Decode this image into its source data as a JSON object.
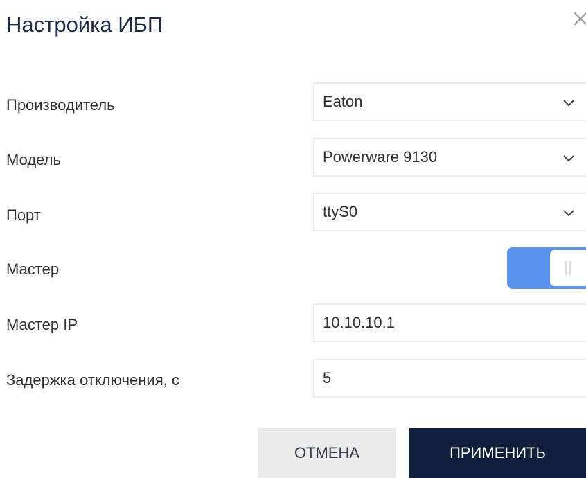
{
  "dialog": {
    "title": "Настройка ИБП",
    "close_icon": "close-icon"
  },
  "form": {
    "manufacturer": {
      "label": "Производитель",
      "value": "Eaton",
      "icon": "chevron-down-icon"
    },
    "model": {
      "label": "Модель",
      "value": "Powerware 9130",
      "icon": "chevron-down-icon"
    },
    "port": {
      "label": "Порт",
      "value": "ttyS0",
      "icon": "chevron-down-icon"
    },
    "master": {
      "label": "Мастер",
      "enabled": true
    },
    "master_ip": {
      "label": "Мастер IP",
      "value": "10.10.10.1"
    },
    "shutdown_delay": {
      "label": "Задержка отключения, с",
      "value": "5"
    }
  },
  "actions": {
    "cancel_label": "ОТМЕНА",
    "apply_label": "ПРИМЕНИТЬ"
  },
  "colors": {
    "title": "#1b2a4a",
    "toggle_on": "#5b93ef",
    "apply_bg": "#0f1f3d",
    "cancel_bg": "#ebebeb"
  }
}
